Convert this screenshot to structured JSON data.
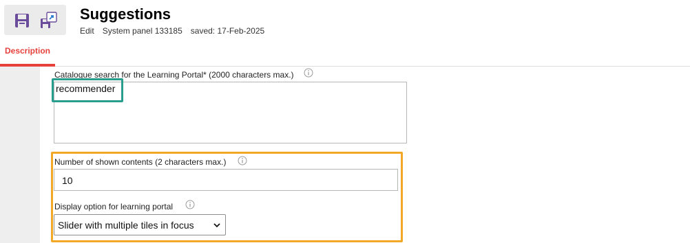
{
  "header": {
    "title": "Suggestions",
    "meta": [
      "Edit",
      "System panel 133185",
      "saved: 17-Feb-2025"
    ]
  },
  "toolbar": {
    "save_icon": "save-icon",
    "save_as_icon": "save-as-icon"
  },
  "tabs": [
    {
      "label": "Description",
      "active": true
    }
  ],
  "form": {
    "catalogue": {
      "label": "Catalogue search for the Learning Portal* (2000 characters max.)",
      "value": "recommender"
    },
    "shown_contents": {
      "label": "Number of shown contents (2 characters max.)",
      "value": "10"
    },
    "display_option": {
      "label": "Display option for learning portal",
      "selected": "Slider with multiple tiles in focus"
    }
  },
  "colors": {
    "accent": "#e8413c",
    "highlight_green": "#2a9d8f",
    "highlight_orange": "#f2a824",
    "icon_purple": "#6b4c9a"
  }
}
